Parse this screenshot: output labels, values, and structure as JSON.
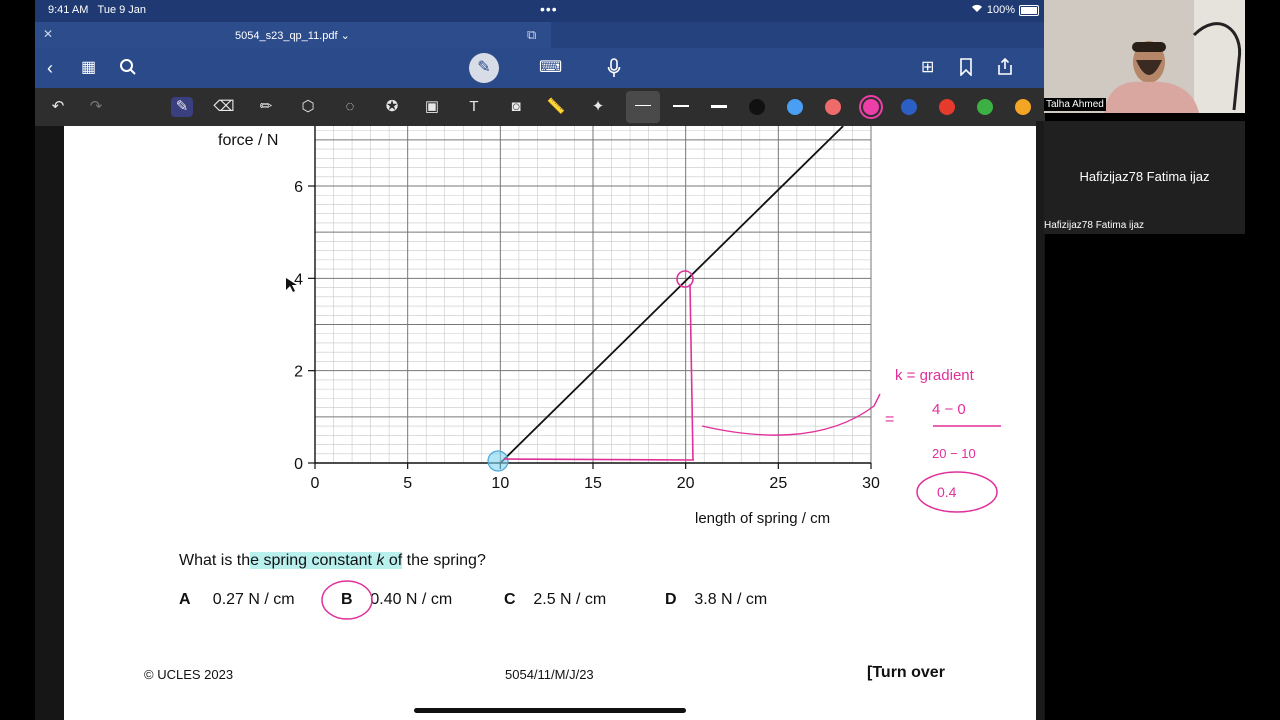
{
  "status": {
    "time": "9:41 AM",
    "date": "Tue 9 Jan",
    "wifi": "wifi-icon",
    "battery_pct": "100%"
  },
  "tab": {
    "title": "5054_s23_qp_11.pdf ⌄"
  },
  "colors": {
    "statusbar": "#1f3a73",
    "ink_pink": "#e0309a",
    "ink_highlight": "#7fd3f0",
    "graph_grid": "#888888"
  },
  "tool_swatches": [
    "#111111",
    "#4a9ff5",
    "#ef6b6b",
    "#ee3fa8",
    "#2b5fc4",
    "#e53a2c",
    "#3cb043",
    "#f5a524"
  ],
  "chart_data": {
    "type": "line",
    "ylabel": "force / N",
    "xlabel": "length of spring / cm",
    "x_ticks": [
      "0",
      "5",
      "10",
      "15",
      "20",
      "25",
      "30"
    ],
    "y_ticks": [
      "0",
      "2",
      "4",
      "6"
    ],
    "xlim": [
      0,
      30
    ],
    "ylim": [
      0,
      7.3
    ],
    "series": [
      {
        "x": [
          10,
          28.5
        ],
        "y": [
          0,
          7.3
        ]
      }
    ],
    "grid": true
  },
  "annotations": {
    "k_eq": "k = gradient",
    "numer": "4 − 0",
    "denom": "20 − 10",
    "result": "0.4",
    "equals": "="
  },
  "question": {
    "pre": "What is th",
    "hl1": "e spring constant ",
    "k": "k",
    "hl2": " of",
    "post": " the spring?"
  },
  "options": [
    {
      "letter": "A",
      "text": "0.27 N / cm"
    },
    {
      "letter": "B",
      "text": "0.40 N / cm"
    },
    {
      "letter": "C",
      "text": "2.5 N / cm"
    },
    {
      "letter": "D",
      "text": "3.8 N / cm"
    }
  ],
  "footer": {
    "copyright": "© UCLES 2023",
    "code": "5054/11/M/J/23",
    "turn": "[Turn over"
  },
  "participants": {
    "presenter": "Talha Ahmed",
    "viewer_center": "Hafizijaz78 Fatima ijaz",
    "viewer_corner": "Hafizijaz78 Fatima ijaz"
  }
}
